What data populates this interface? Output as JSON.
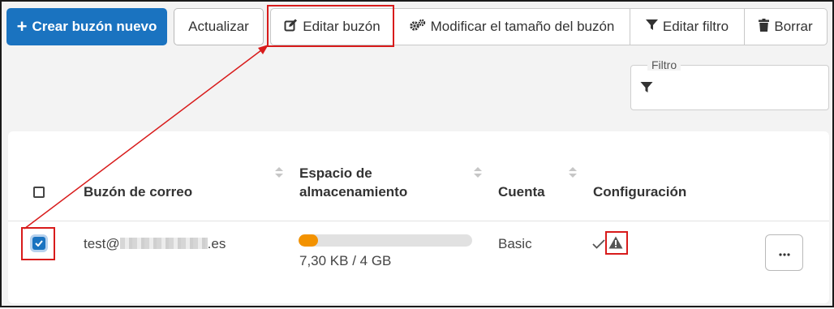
{
  "toolbar": {
    "create_label": "Crear buzón nuevo",
    "refresh_label": "Actualizar",
    "edit_label": "Editar buzón",
    "resize_label": "Modificar el tamaño del buzón",
    "edit_filter_label": "Editar filtro",
    "delete_label": "Borrar"
  },
  "filter": {
    "legend": "Filtro",
    "icon": "filter-icon"
  },
  "table": {
    "columns": [
      "Buzón de correo",
      "Espacio de almacenamiento",
      "Cuenta",
      "Configuración"
    ],
    "columns_line": {
      "storage_line1": "Espacio de",
      "storage_line2": "almacenamiento"
    },
    "rows": [
      {
        "selected": true,
        "email_prefix": "test@",
        "email_suffix": ".es",
        "storage_used_fraction": 0.11,
        "storage_text": "7,30 KB / 4 GB",
        "account": "Basic",
        "config_icons": [
          "check-icon",
          "warning-icon"
        ],
        "actions_label": "···"
      }
    ]
  },
  "colors": {
    "primary": "#1a73c0",
    "highlight": "#d81b1b",
    "progress": "#f39200"
  }
}
